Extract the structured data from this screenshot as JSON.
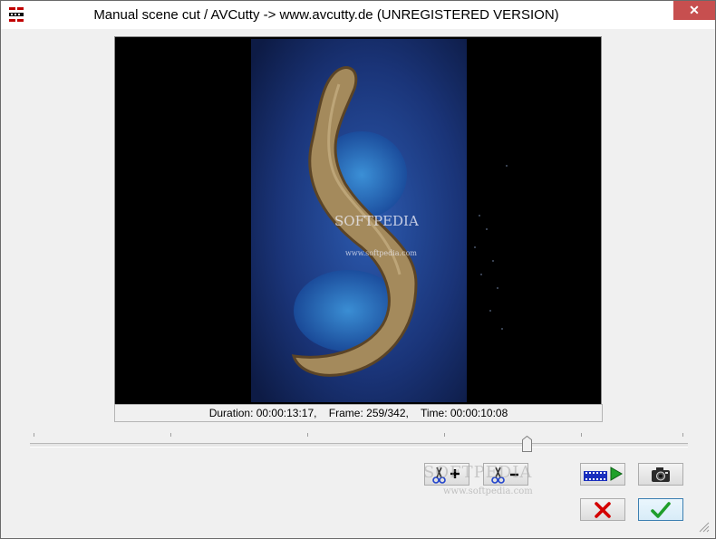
{
  "window": {
    "title": "Manual scene cut / AVCutty -> www.avcutty.de (UNREGISTERED VERSION)",
    "close_glyph": "✕",
    "app_icon": "avcutty-app-icon"
  },
  "video": {
    "watermark_main": "SOFTPEDIA",
    "watermark_url": "www.softpedia.com"
  },
  "info": {
    "text": "Duration: 00:00:13:17,    Frame: 259/342,    Time: 00:00:10:08"
  },
  "slider": {
    "position_fraction": 0.756,
    "frame": 259,
    "frames_total": 342
  },
  "buttons": {
    "add_cut": {
      "icon": "scissors-plus-icon",
      "symbol": "+"
    },
    "remove_cut": {
      "icon": "scissors-minus-icon",
      "symbol": "−"
    },
    "play": {
      "icon": "film-play-icon"
    },
    "snapshot": {
      "icon": "camera-icon"
    },
    "cancel": {
      "icon": "red-x-icon"
    },
    "ok": {
      "icon": "green-check-icon"
    }
  },
  "overlay_watermark": {
    "main": "SOFTPEDIA",
    "url": "www.softpedia.com"
  },
  "colors": {
    "accent_close": "#c74f4f",
    "cancel_red": "#d40000",
    "ok_green": "#1f9e2a",
    "play_green": "#1fa02a",
    "film_blue": "#1a2fbd"
  }
}
